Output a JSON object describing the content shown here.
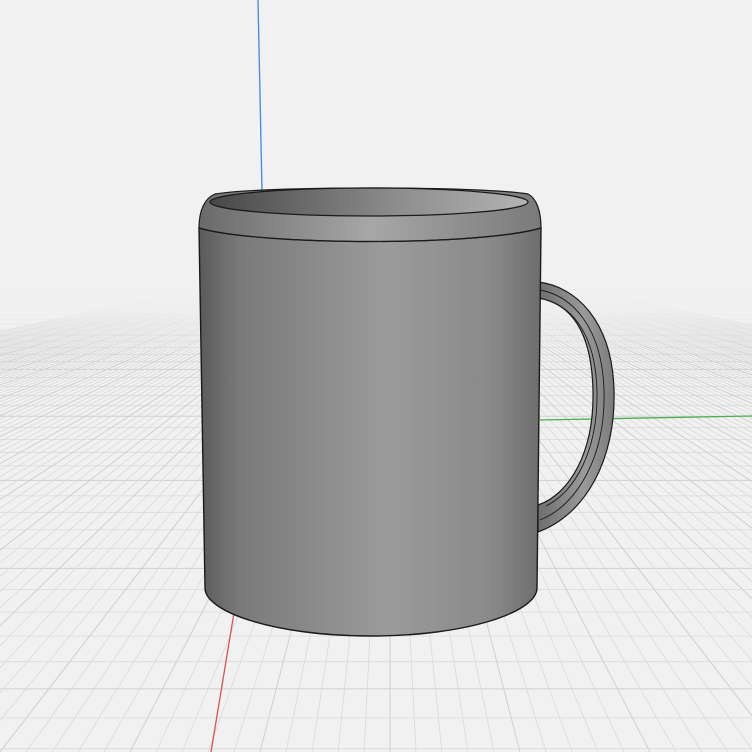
{
  "viewport": {
    "background_color": "#f1f1f1",
    "grid_color": "#d9d9d9",
    "grid_major_color": "#cfcfcf"
  },
  "axes": {
    "x_color": "#d9534f",
    "y_color": "#4caf50",
    "z_color": "#4a90e2"
  },
  "model": {
    "shape": "mug",
    "body_color": "#8a8a8a",
    "edge_color": "#1a1a1a",
    "handle_color": "#858585"
  }
}
